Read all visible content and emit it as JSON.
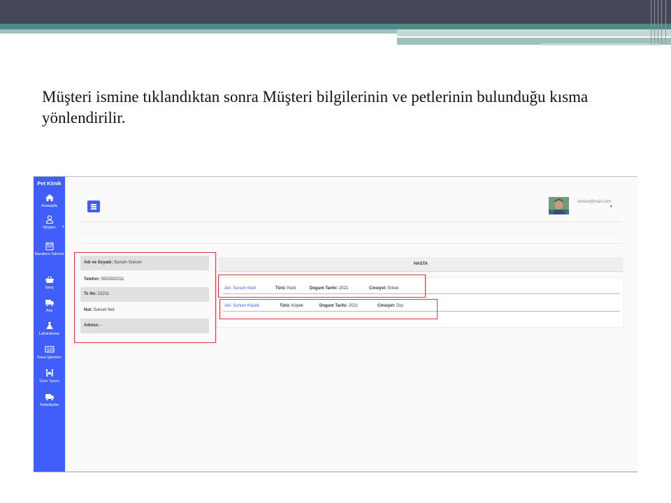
{
  "slide": {
    "text": "Müşteri ismine tıklandıktan sonra Müşteri bilgilerinin ve petlerinin bulunduğu kısma yönlendirilir."
  },
  "app": {
    "brand": "Pet Klinik",
    "nav": [
      {
        "label": "Anasayfa",
        "icon": "home-icon"
      },
      {
        "label": "Müşteri",
        "icon": "user-icon"
      },
      {
        "label": "Randevu Takvimi",
        "icon": "calendar-icon"
      },
      {
        "label": "Satış",
        "icon": "basket-icon"
      },
      {
        "label": "Alış",
        "icon": "truck-icon"
      },
      {
        "label": "Labaratuvar",
        "icon": "flask-icon"
      },
      {
        "label": "Kasa İşlemleri",
        "icon": "cash-icon"
      },
      {
        "label": "Ürün Tanım",
        "icon": "people-carry-icon"
      },
      {
        "label": "Tedarikçiler",
        "icon": "truck-icon"
      }
    ],
    "user_email": "serkan@mail.com",
    "customer": {
      "name_label": "Adı ve Soyadı:",
      "name_value": "Sunum Sunum",
      "phone_label": "Telefon:",
      "phone_value": "5553332211",
      "tc_label": "Tc No:",
      "tc_value": "22211",
      "note_label": "Not:",
      "note_value": "Sunum Not",
      "address_label": "Adress:",
      "address_value": "-"
    },
    "patients": {
      "header": "HASTA",
      "rows": [
        {
          "name": "Adı: Sunum Kedi",
          "type_label": "Türü:",
          "type": "Kedi",
          "dob_label": "Dogum Tarihi:",
          "dob": "2021",
          "gender_label": "Cinsiyet:",
          "gender": "Erkek"
        },
        {
          "name": "Adı: Sunum Köpek",
          "type_label": "Türü:",
          "type": "Köpek",
          "dob_label": "Dogum Tarihi:",
          "dob": "2021",
          "gender_label": "Cinsiyet:",
          "gender": "Dişi"
        }
      ]
    },
    "colors": {
      "sidebar": "#3f5efb",
      "highlight": "#d9383f"
    }
  }
}
